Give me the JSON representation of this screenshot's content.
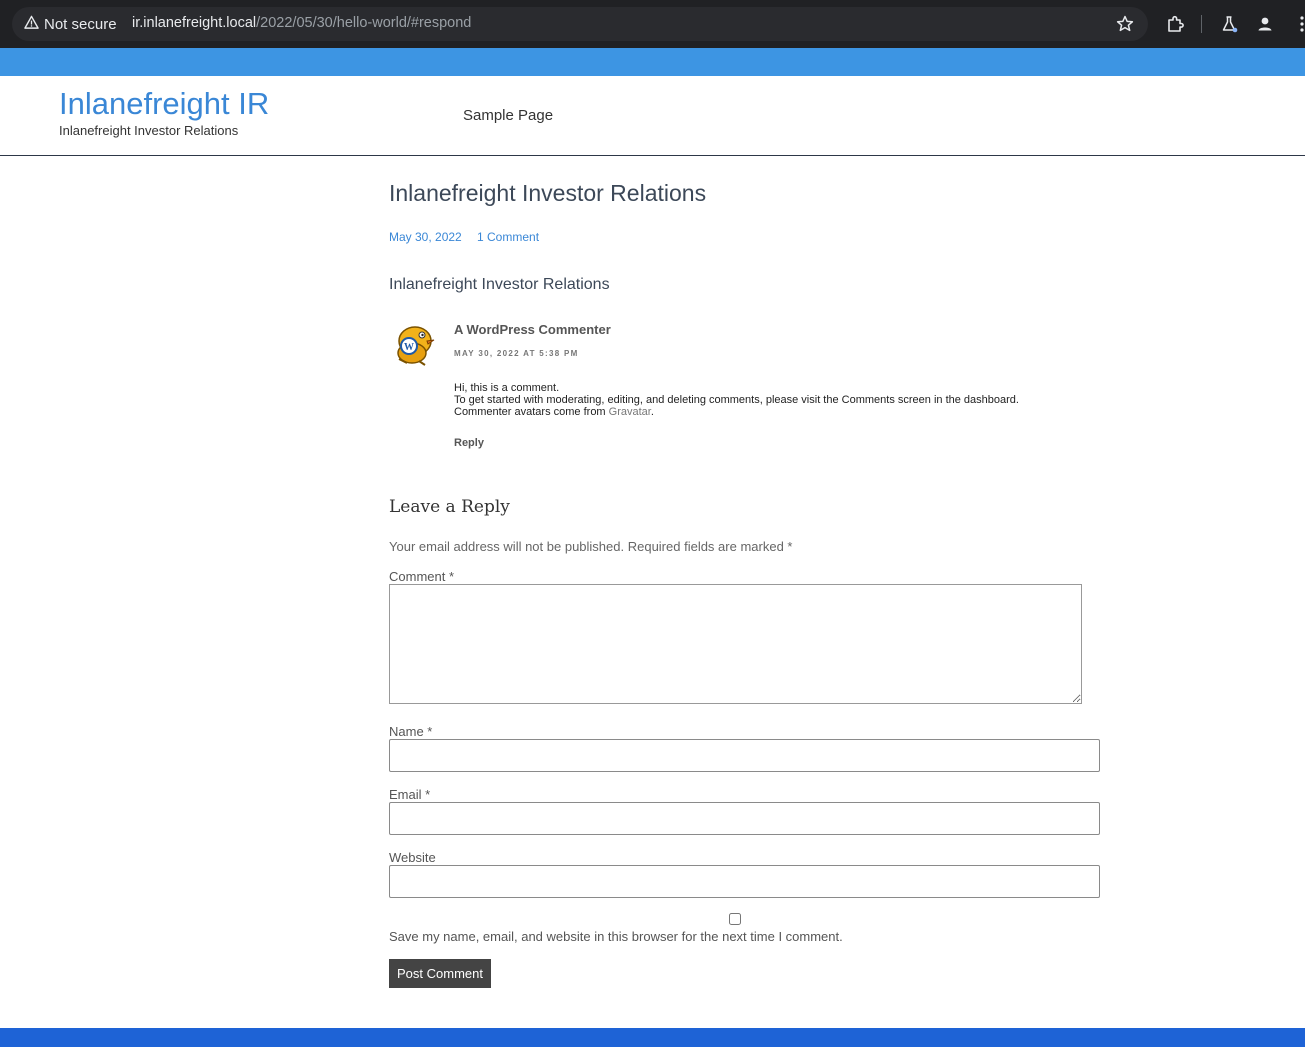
{
  "browser": {
    "security_label": "Not secure",
    "url_host": "ir.inlanefreight.local",
    "url_path": "/2022/05/30/hello-world/#respond"
  },
  "header": {
    "site_title": "Inlanefreight IR",
    "tagline": "Inlanefreight Investor Relations",
    "nav_items": [
      "Sample Page"
    ]
  },
  "post": {
    "title": "Inlanefreight Investor Relations",
    "date": "May 30, 2022",
    "comment_count": "1 Comment"
  },
  "comments": {
    "heading": "Inlanefreight Investor Relations",
    "items": [
      {
        "author": "A WordPress Commenter",
        "date": "MAY 30, 2022 AT 5:38 PM",
        "line1": "Hi, this is a comment.",
        "line2": "To get started with moderating, editing, and deleting comments, please visit the Comments screen in the dashboard.",
        "line3_prefix": "Commenter avatars come from ",
        "line3_link": "Gravatar",
        "line3_suffix": ".",
        "reply_label": "Reply"
      }
    ]
  },
  "reply_form": {
    "title": "Leave a Reply",
    "notes": "Your email address will not be published. Required fields are marked *",
    "comment_label": "Comment *",
    "name_label": "Name *",
    "email_label": "Email *",
    "website_label": "Website",
    "cookies_label": "Save my name, email, and website in this browser for the next time I comment.",
    "submit_label": "Post Comment"
  },
  "colors": {
    "top_strip": "#3d95e3",
    "link": "#3a87d6",
    "footer_strip": "#1e63d6"
  }
}
